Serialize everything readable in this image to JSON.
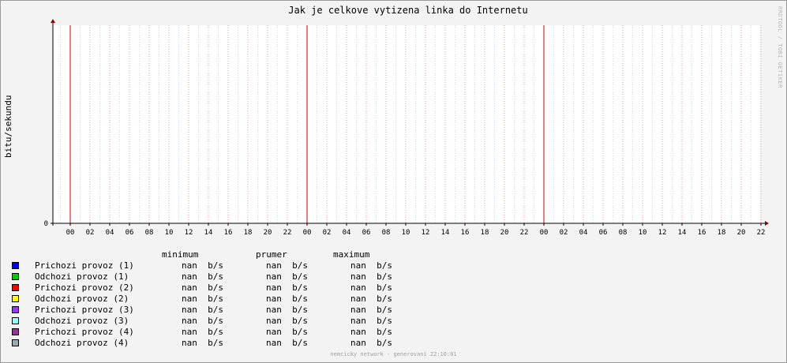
{
  "chart_data": {
    "type": "line",
    "title": "Jak je celkove vytizena linka do Internetu",
    "ylabel": "bitu/sekundu",
    "xlabel": "",
    "y_ticks": [
      "0"
    ],
    "x_ticks": [
      "00",
      "02",
      "04",
      "06",
      "08",
      "10",
      "12",
      "14",
      "16",
      "18",
      "20",
      "22",
      "00",
      "02",
      "04",
      "06",
      "08",
      "10",
      "12",
      "14",
      "16",
      "18",
      "20",
      "22",
      "00",
      "02",
      "04",
      "06",
      "08",
      "10",
      "12",
      "14",
      "16",
      "18",
      "20",
      "22"
    ],
    "day_boundaries": [
      "00",
      "00",
      "00"
    ],
    "grid": true,
    "legend_placement": "bottom",
    "series": [
      {
        "name": "Prichozi provoz (1)",
        "color": "#0000ff",
        "values": []
      },
      {
        "name": "Odchozi provoz (1)",
        "color": "#00cc00",
        "values": []
      },
      {
        "name": "Prichozi provoz (2)",
        "color": "#ff0000",
        "values": []
      },
      {
        "name": "Odchozi provoz (2)",
        "color": "#ffff00",
        "values": []
      },
      {
        "name": "Prichozi provoz (3)",
        "color": "#9933ff",
        "values": []
      },
      {
        "name": "Odchozi provoz (3)",
        "color": "#99ffff",
        "values": []
      },
      {
        "name": "Prichozi provoz (4)",
        "color": "#993399",
        "values": []
      },
      {
        "name": "Odchozi provoz (4)",
        "color": "#99aaaa",
        "values": []
      }
    ]
  },
  "legend": {
    "headers": {
      "minimum": "minimum",
      "prumer": "prumer",
      "maximum": "maximum"
    },
    "rows": [
      {
        "label": "Prichozi provoz (1)",
        "min": "nan  b/s",
        "avg": "nan  b/s",
        "max": "nan  b/s",
        "color": "#0000ff"
      },
      {
        "label": "Odchozi provoz (1)",
        "min": "nan  b/s",
        "avg": "nan  b/s",
        "max": "nan  b/s",
        "color": "#00cc00"
      },
      {
        "label": "Prichozi provoz (2)",
        "min": "nan  b/s",
        "avg": "nan  b/s",
        "max": "nan  b/s",
        "color": "#ff0000"
      },
      {
        "label": "Odchozi provoz (2)",
        "min": "nan  b/s",
        "avg": "nan  b/s",
        "max": "nan  b/s",
        "color": "#ffff00"
      },
      {
        "label": "Prichozi provoz (3)",
        "min": "nan  b/s",
        "avg": "nan  b/s",
        "max": "nan  b/s",
        "color": "#9933ff"
      },
      {
        "label": "Odchozi provoz (3)",
        "min": "nan  b/s",
        "avg": "nan  b/s",
        "max": "nan  b/s",
        "color": "#99ffff"
      },
      {
        "label": "Prichozi provoz (4)",
        "min": "nan  b/s",
        "avg": "nan  b/s",
        "max": "nan  b/s",
        "color": "#993399"
      },
      {
        "label": "Odchozi provoz (4)",
        "min": "nan  b/s",
        "avg": "nan  b/s",
        "max": "nan  b/s",
        "color": "#99aaaa"
      }
    ]
  },
  "watermark": "RRDTOOL / TOBI OETIKER",
  "footer": "nemcicky network - generovani 22:10:01"
}
